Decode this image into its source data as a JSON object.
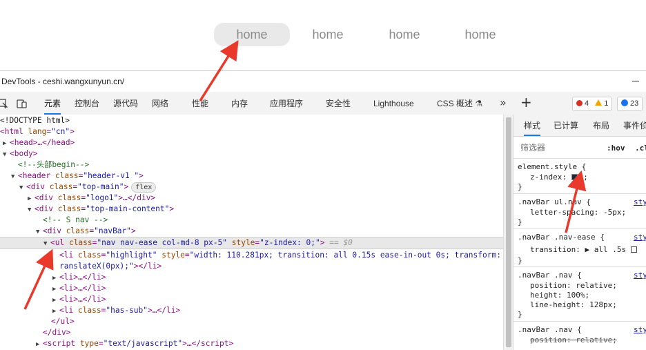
{
  "navbar": {
    "items": [
      {
        "label": "home",
        "highlighted": true
      },
      {
        "label": "home",
        "highlighted": false
      },
      {
        "label": "home",
        "highlighted": false
      },
      {
        "label": "home",
        "highlighted": false
      }
    ]
  },
  "devtools": {
    "window_title": "DevTools - ceshi.wangxunyun.cn/",
    "tabs": [
      "元素",
      "控制台",
      "源代码",
      "网络",
      "性能",
      "内存",
      "应用程序",
      "安全性",
      "Lighthouse",
      "CSS 概述"
    ],
    "active_tab": "元素",
    "errors": "4",
    "warnings": "1",
    "issues": "23"
  },
  "dom": {
    "l0": "<!DOCTYPE html>",
    "l1_tag": "<html",
    "l1_attr": "lang",
    "l1_val": "\"cn\"",
    "l2": "<head>…</head>",
    "l3": "<body>",
    "l4": "<!--头部begin-->",
    "l5_attr": "class",
    "l5_val": "\"header-v1  \"",
    "l6_val": "\"top-main\"",
    "l6_pill": "flex",
    "l7_val": "\"logo1\"",
    "l8_val": "\"top-main-content\"",
    "l9": "<!-- S nav -->",
    "l10_val": "\"navBar\"",
    "l11_val": "\"nav nav-ease col-md-8 px-5\"",
    "l11_style": "\"z-index: 0;\"",
    "l11_eq": "== $0",
    "l12_class": "\"highlight\"",
    "l12_style": "\"width: 110.281px; transition: all 0.15s ease-in-out 0s; transform: t",
    "l13": "ranslateX(0px);\"",
    "li": "<li>…</li>",
    "l17_val": "\"has-sub\"",
    "l18": "</ul>",
    "l19": "</div>",
    "l20_val": "\"text/javascript\""
  },
  "styles": {
    "subtabs": [
      "样式",
      "已计算",
      "布局",
      "事件侦"
    ],
    "filter_placeholder": "筛选器",
    "hov": ":hov",
    "cls": ".cl",
    "rules": [
      {
        "selector": "element.style {",
        "props": [
          {
            "name": "z-index",
            "value": "0;"
          }
        ]
      },
      {
        "selector": ".navBar ul.nav {",
        "source": "sty",
        "props": [
          {
            "name": "letter-spacing",
            "value": "-5px;"
          }
        ]
      },
      {
        "selector": ".navBar .nav-ease {",
        "source": "sty",
        "props": [
          {
            "name": "transition",
            "value": "all .5s"
          }
        ]
      },
      {
        "selector": ".navBar .nav {",
        "source": "sty",
        "props": [
          {
            "name": "position",
            "value": "relative;"
          },
          {
            "name": "height",
            "value": "100%;"
          },
          {
            "name": "line-height",
            "value": "128px;"
          }
        ]
      },
      {
        "selector": ".navBar .nav {",
        "source": "sty",
        "props": [
          {
            "name": "position",
            "value": "relative;"
          }
        ]
      }
    ]
  },
  "colors": {
    "arrow": "#e8392a",
    "active_tab_underline": "#1a73e8"
  }
}
